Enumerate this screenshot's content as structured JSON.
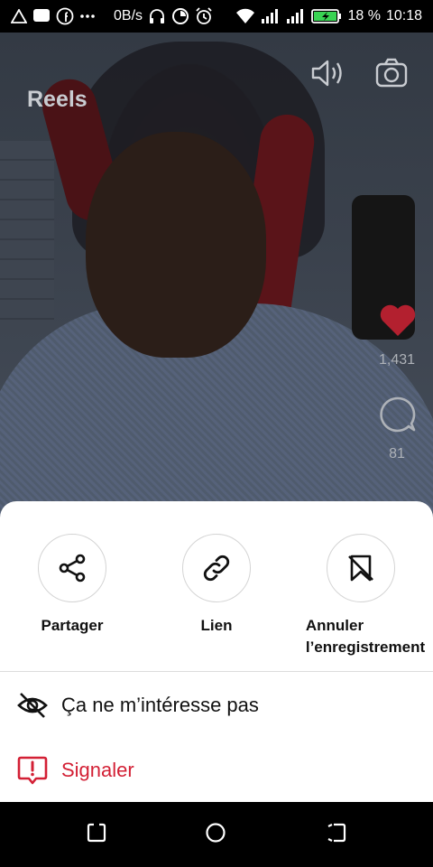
{
  "status_bar": {
    "speed": "0B/s",
    "battery": "18 %",
    "time": "10:18",
    "icons": [
      "warning-icon",
      "chat-icon",
      "facebook-icon",
      "more-dots-icon",
      "headset-icon",
      "data-saver-icon",
      "alarm-icon",
      "wifi-icon",
      "signal-icon",
      "signal-icon-2",
      "battery-icon"
    ]
  },
  "video": {
    "title": "Reels",
    "likes": "1,431",
    "comments": "81",
    "icons": [
      "volume-icon",
      "camera-icon",
      "heart-icon",
      "comment-icon"
    ],
    "like_color": "#d32035"
  },
  "sheet": {
    "actions": [
      {
        "label": "Partager",
        "icon": "share-icon"
      },
      {
        "label": "Lien",
        "icon": "link-icon"
      },
      {
        "label_line1": "Annuler",
        "label_line2": "l’enregistrement",
        "icon": "unsave-icon"
      }
    ],
    "options": [
      {
        "label": "Ça ne m’intéresse pas",
        "icon": "eye-off-icon"
      },
      {
        "label": "Signaler",
        "icon": "report-icon",
        "color": "#d32035"
      }
    ]
  },
  "navbar": {
    "icons": [
      "recent-apps-icon",
      "home-icon",
      "back-icon"
    ]
  }
}
